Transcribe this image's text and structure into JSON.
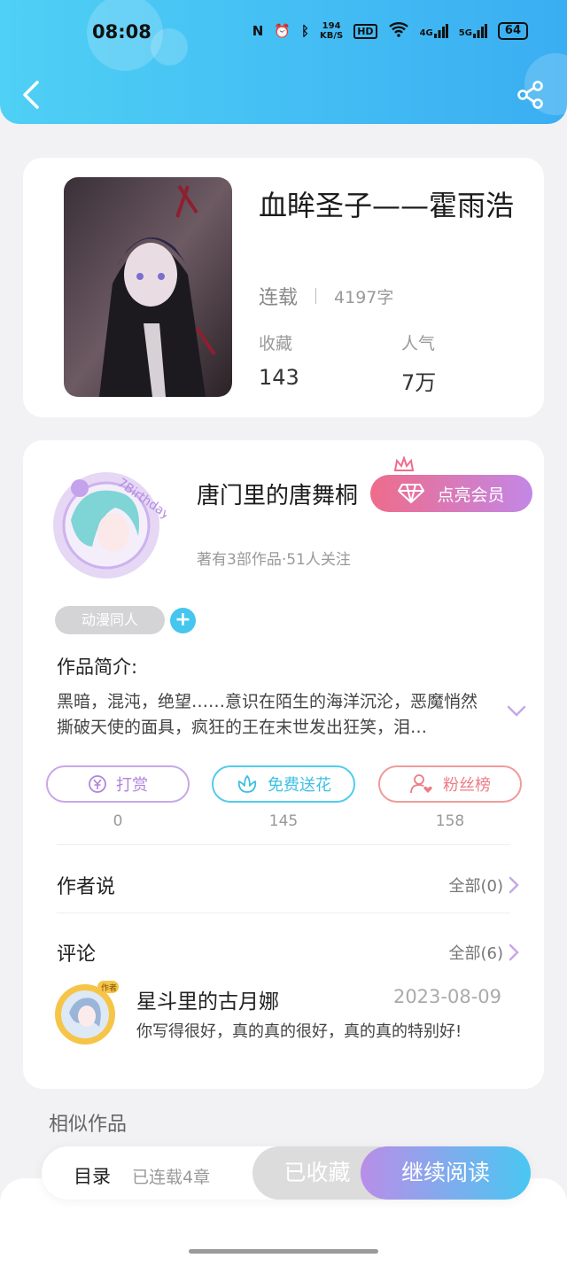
{
  "status_bar": {
    "time": "08:08",
    "net_speed_value": "194",
    "net_speed_unit": "KB/S",
    "hd_label": "HD",
    "signal_1": "4G",
    "signal_2": "5G",
    "battery": "64"
  },
  "book": {
    "title": "血眸圣子——霍雨浩",
    "status": "连载",
    "word_count": "4197字",
    "collect_label": "收藏",
    "collect_value": "143",
    "popularity_label": "人气",
    "popularity_value": "7万"
  },
  "author": {
    "name": "唐门里的唐舞桐",
    "vip_button": "点亮会员",
    "meta": "著有3部作品·51人关注",
    "tag": "动漫同人",
    "add_tag": "+"
  },
  "intro": {
    "heading": "作品简介:",
    "text": "黑暗，混沌，绝望……意识在陌生的海洋沉沦，恶魔悄然撕破天使的面具，疯狂的王在末世发出狂笑，泪…"
  },
  "actions": {
    "reward_label": "打赏",
    "reward_count": "0",
    "flower_label": "免费送花",
    "flower_count": "145",
    "fans_label": "粉丝榜",
    "fans_count": "158"
  },
  "author_says": {
    "title": "作者说",
    "more": "全部(0)"
  },
  "comments": {
    "title": "评论",
    "more": "全部(6)",
    "items": [
      {
        "user": "星斗里的古月娜",
        "date": "2023-08-09",
        "text": "你写得很好，真的真的很好，真的真的特别好!",
        "badge": "作者"
      }
    ]
  },
  "similar": {
    "title": "相似作品"
  },
  "bottom_bar": {
    "toc": "目录",
    "chapters": "已连载4章",
    "collected": "已收藏",
    "continue": "继续阅读"
  },
  "colors": {
    "header_start": "#4fd0f5",
    "header_end": "#3aaef2",
    "vip_start": "#ee6c8b",
    "vip_end": "#c387e6",
    "accent_blue": "#45c6ef",
    "reward_purple": "#b084de",
    "fans_red": "#ee7b86"
  }
}
